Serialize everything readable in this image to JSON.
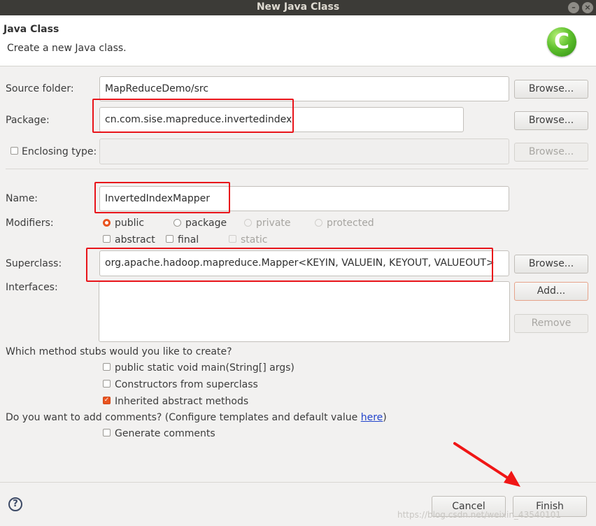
{
  "window": {
    "title": "New Java Class"
  },
  "header": {
    "title": "Java Class",
    "subtitle": "Create a new Java class.",
    "logo_letter": "C"
  },
  "form": {
    "source_folder": {
      "label": "Source folder:",
      "value": "MapReduceDemo/src",
      "browse": "Browse..."
    },
    "package": {
      "label": "Package:",
      "value": "cn.com.sise.mapreduce.invertedindex",
      "browse": "Browse..."
    },
    "enclosing_type": {
      "label": "Enclosing type:",
      "checked": false,
      "value": "",
      "browse": "Browse..."
    },
    "name": {
      "label": "Name:",
      "value": "InvertedIndexMapper"
    },
    "modifiers": {
      "label": "Modifiers:",
      "access": [
        {
          "label": "public",
          "selected": true,
          "enabled": true
        },
        {
          "label": "package",
          "selected": false,
          "enabled": true
        },
        {
          "label": "private",
          "selected": false,
          "enabled": false
        },
        {
          "label": "protected",
          "selected": false,
          "enabled": false
        }
      ],
      "flags": [
        {
          "label": "abstract",
          "checked": false,
          "enabled": true
        },
        {
          "label": "final",
          "checked": false,
          "enabled": true
        },
        {
          "label": "static",
          "checked": false,
          "enabled": false
        }
      ]
    },
    "superclass": {
      "label": "Superclass:",
      "value": "org.apache.hadoop.mapreduce.Mapper<KEYIN, VALUEIN, KEYOUT, VALUEOUT>",
      "browse": "Browse..."
    },
    "interfaces": {
      "label": "Interfaces:",
      "add": "Add...",
      "remove": "Remove"
    }
  },
  "stubs": {
    "question": "Which method stubs would you like to create?",
    "options": [
      {
        "label": "public static void main(String[] args)",
        "checked": false
      },
      {
        "label": "Constructors from superclass",
        "checked": false
      },
      {
        "label": "Inherited abstract methods",
        "checked": true
      }
    ]
  },
  "comments": {
    "question_prefix": "Do you want to add comments? (Configure templates and default value ",
    "link": "here",
    "question_suffix": ")",
    "option": {
      "label": "Generate comments",
      "checked": false
    }
  },
  "footer": {
    "help": "?",
    "cancel": "Cancel",
    "finish": "Finish"
  },
  "watermark": "https://blog.csdn.net/weixin_43540101"
}
